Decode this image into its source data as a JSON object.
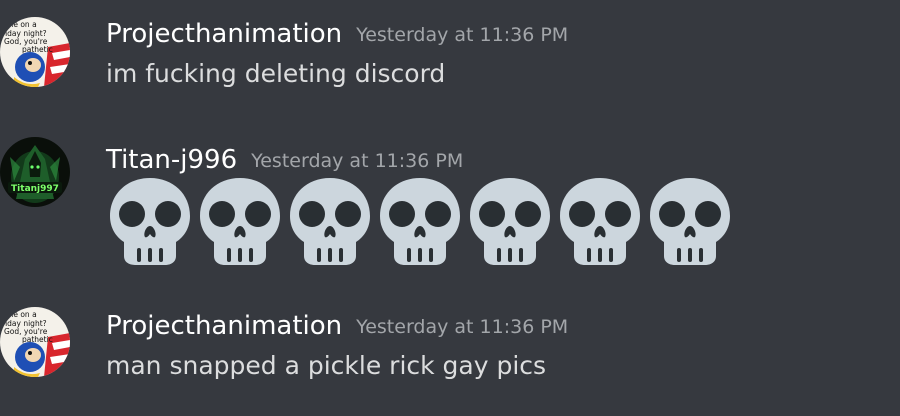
{
  "messages": [
    {
      "author": "Projecthanimation",
      "timestamp": "Yesterday at 11:36 PM",
      "text": "im fucking deleting discord",
      "avatar_caption": "one on a\nriday night?\nGod, you're\npathetic"
    },
    {
      "author": "Titan-j996",
      "timestamp": "Yesterday at 11:36 PM",
      "emoji": [
        "skull",
        "skull",
        "skull",
        "skull",
        "skull",
        "skull",
        "skull"
      ],
      "avatar_caption": "Titanj997"
    },
    {
      "author": "Projecthanimation",
      "timestamp": "Yesterday at 11:36 PM",
      "text": "man snapped a pickle rick gay pics",
      "avatar_caption": "one on a\nriday night?\nGod, you're\npathetic"
    }
  ],
  "colors": {
    "background": "#36393f",
    "username": "#ffffff",
    "timestamp": "#a3a6aa",
    "text": "#dcddde",
    "skull": "#ccd6dd",
    "skull_features": "#292f33"
  }
}
